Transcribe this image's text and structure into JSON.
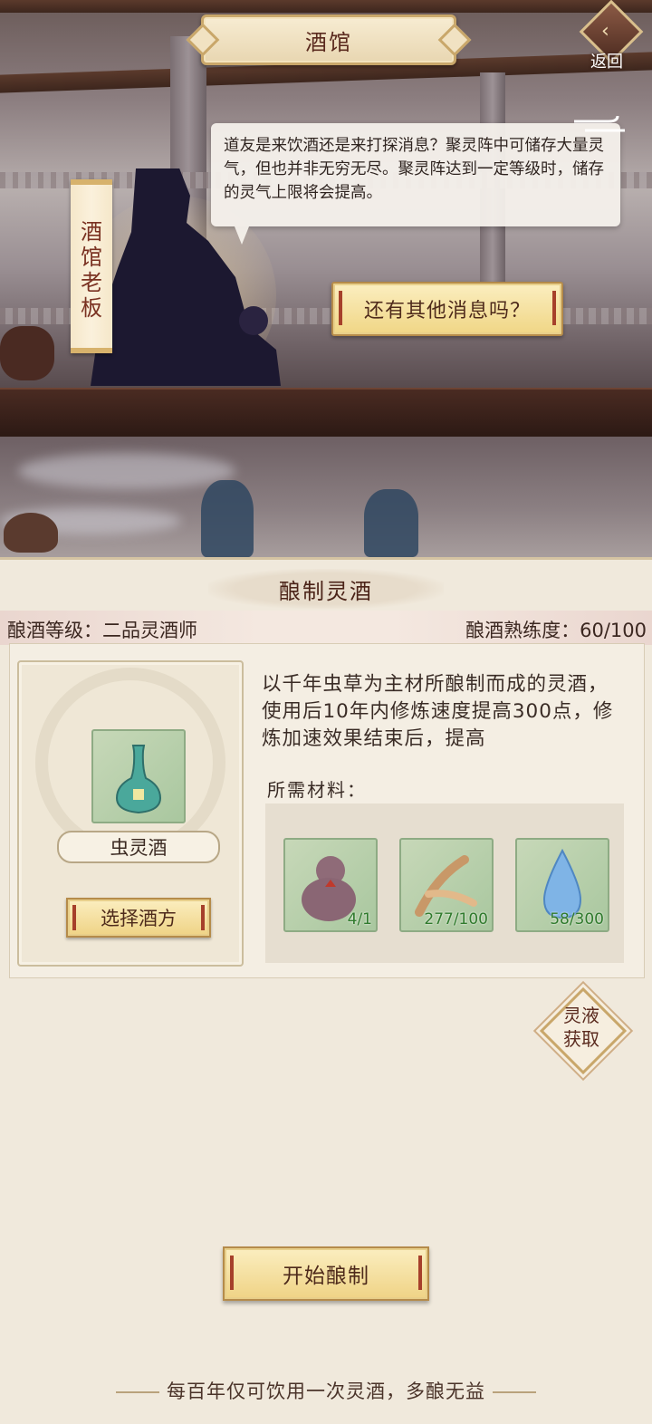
{
  "header": {
    "title": "酒馆",
    "back_label": "返回"
  },
  "npc": {
    "name": "酒馆老板",
    "name_chars": [
      "酒",
      "馆",
      "老",
      "板"
    ],
    "dialog": "道友是来饮酒还是来打探消息？聚灵阵中可储存大量灵气，但也并非无穷无尽。聚灵阵达到一定等级时，储存的灵气上限将会提高。",
    "option_button": "还有其他消息吗？"
  },
  "brew": {
    "title": "酿制灵酒",
    "level_text": "酿酒等级：二品灵酒师",
    "proficiency_text": "酿酒熟练度：60/100",
    "proficiency": {
      "current": 60,
      "max": 100
    },
    "item_name": "虫灵酒",
    "select_button": "选择酒方",
    "description": "以千年虫草为主材所酿制而成的灵酒，使用后10年内修炼速度提高300点，修炼加速效果结束后，提高",
    "materials_label": "所需材料：",
    "materials": [
      {
        "icon": "gourd-icon",
        "count": "4/1"
      },
      {
        "icon": "cordyceps-icon",
        "count": "277/100"
      },
      {
        "icon": "spirit-liquid-icon",
        "count": "58/300"
      }
    ],
    "liquid_button": [
      "灵液",
      "获取"
    ],
    "start_button": "开始酿制",
    "footer_note": "每百年仅可饮用一次灵酒，多酿无益"
  },
  "colors": {
    "accent_text": "#5a2a1e",
    "button_gold": "#f0d685",
    "material_count": "#2f7a2c"
  }
}
